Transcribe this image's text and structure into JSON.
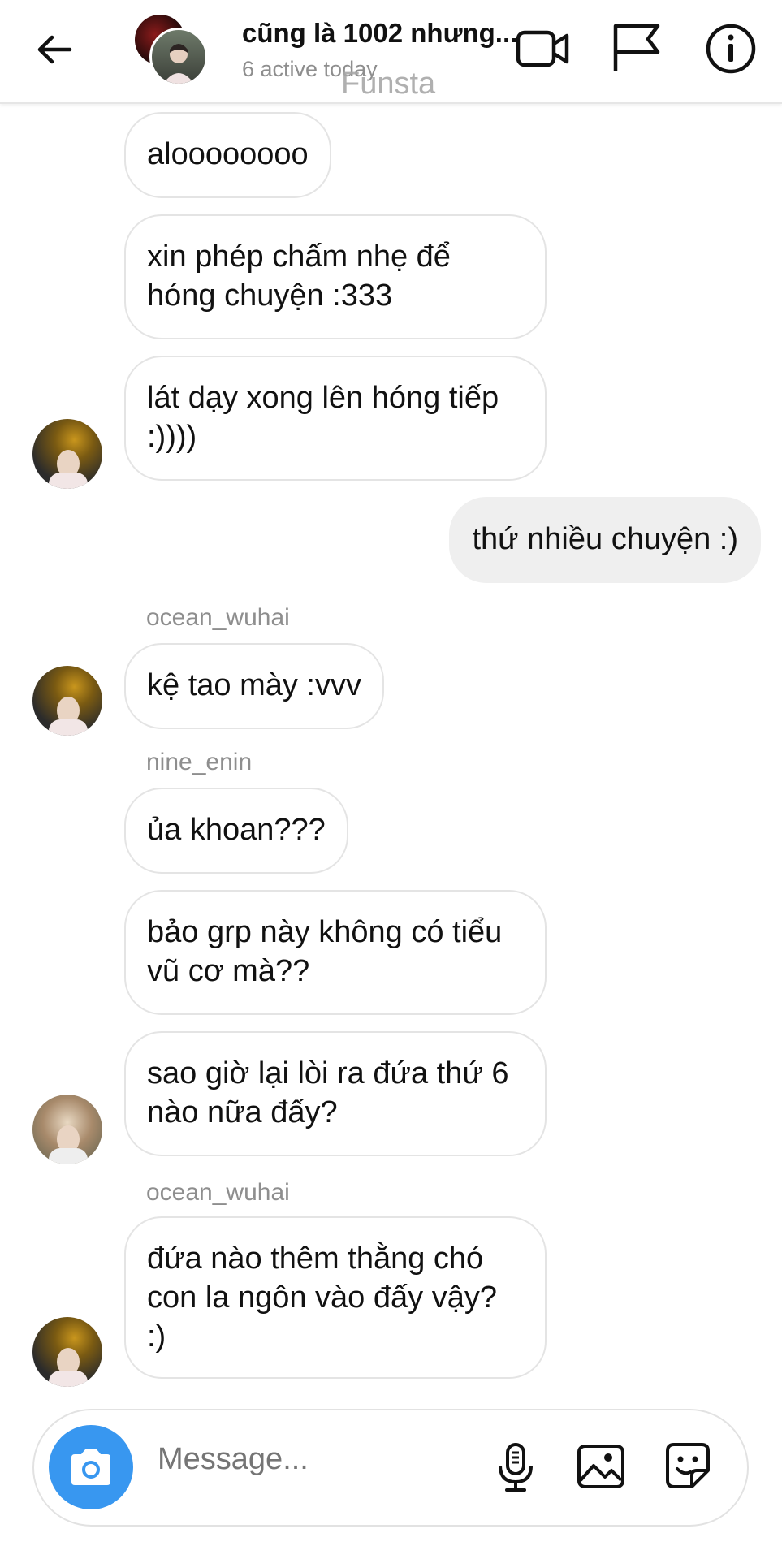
{
  "header": {
    "title": "cũng là 1002 nhưng...",
    "subtitle": "6 active today",
    "watermark": "Funsta"
  },
  "messages": [
    {
      "text": "aloooooooo",
      "mine": false
    },
    {
      "text": "xin phép chấm nhẹ để hóng chuyện :333",
      "mine": false
    },
    {
      "text": "lát dạy xong lên hóng tiếp :))))",
      "mine": false
    },
    {
      "text": "thứ nhiều chuyện :)",
      "mine": true
    },
    {
      "sender": "ocean_wuhai"
    },
    {
      "text": "kệ tao mày :vvv",
      "mine": false
    },
    {
      "sender": "nine_enin"
    },
    {
      "text": "ủa khoan???",
      "mine": false
    },
    {
      "text": "bảo grp này không có tiểu vũ cơ mà??",
      "mine": false
    },
    {
      "text": "sao giờ lại lòi ra đứa thứ 6 nào nữa đấy?",
      "mine": false
    },
    {
      "sender": "ocean_wuhai"
    },
    {
      "text": "đứa nào thêm thằng chó con la ngôn vào đấy vậy? :)",
      "mine": false
    }
  ],
  "composer": {
    "placeholder": "Message..."
  },
  "icons": {
    "back": "arrow-left-icon",
    "video": "video-call-icon",
    "flag": "flag-icon",
    "info": "info-icon",
    "camera": "camera-icon",
    "mic": "microphone-icon",
    "gallery": "gallery-icon",
    "sticker": "sticker-icon"
  },
  "colors": {
    "accent": "#3897f0",
    "bubble_mine": "#efefef",
    "muted_text": "#8e8e8e"
  }
}
